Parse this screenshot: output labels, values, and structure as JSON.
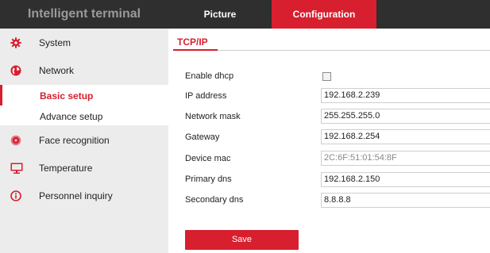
{
  "header": {
    "brand": "Intelligent terminal",
    "tabs": [
      {
        "label": "Picture",
        "active": false
      },
      {
        "label": "Configuration",
        "active": true
      }
    ]
  },
  "sidebar": {
    "items": [
      {
        "label": "System",
        "icon": "gear-icon"
      },
      {
        "label": "Network",
        "icon": "globe-icon"
      },
      {
        "label": "Face recognition",
        "icon": "camera-icon"
      },
      {
        "label": "Temperature",
        "icon": "monitor-icon"
      },
      {
        "label": "Personnel inquiry",
        "icon": "info-icon"
      }
    ],
    "network_sub": [
      {
        "label": "Basic setup",
        "active": true
      },
      {
        "label": "Advance setup",
        "active": false
      }
    ]
  },
  "content": {
    "title": "TCP/IP",
    "fields": {
      "enable_dhcp": {
        "label": "Enable dhcp",
        "checked": false
      },
      "ip_address": {
        "label": "IP address",
        "value": "192.168.2.239"
      },
      "network_mask": {
        "label": "Network mask",
        "value": "255.255.255.0"
      },
      "gateway": {
        "label": "Gateway",
        "value": "192.168.2.254"
      },
      "device_mac": {
        "label": "Device mac",
        "value": "2C:6F:51:01:54:8F"
      },
      "primary_dns": {
        "label": "Primary dns",
        "value": "192.168.2.150"
      },
      "secondary_dns": {
        "label": "Secondary dns",
        "value": "8.8.8.8"
      }
    },
    "save_label": "Save"
  },
  "colors": {
    "accent": "#d71f2f",
    "topbar": "#2f2f2f",
    "sidebar": "#ececec"
  }
}
